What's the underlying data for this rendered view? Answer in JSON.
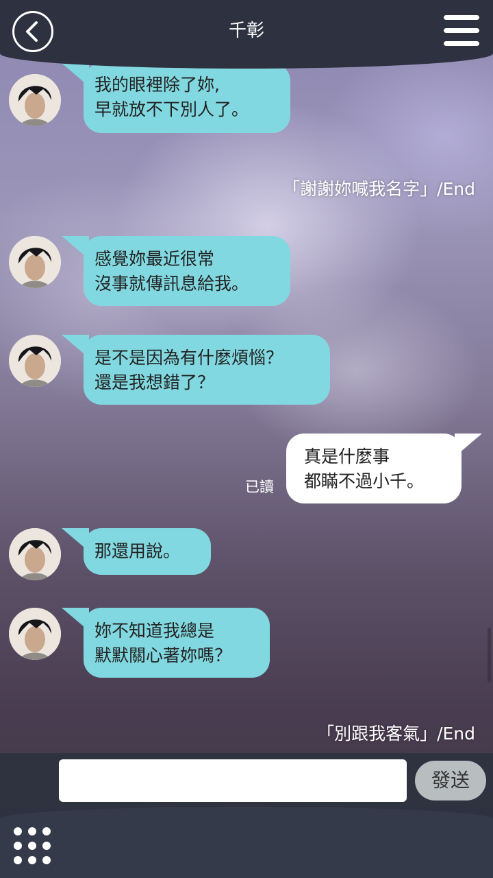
{
  "header": {
    "title": "千彰",
    "back_icon": "chevron-left-icon",
    "menu_icon": "hamburger-menu-icon"
  },
  "messages": [
    {
      "sender": "other",
      "lines": [
        "我的眼裡除了妳,",
        "早就放不下別人了。"
      ]
    },
    {
      "sender": "system",
      "text": "「謝謝妳喊我名字」/End"
    },
    {
      "sender": "other",
      "lines": [
        "感覺妳最近很常",
        "沒事就傳訊息給我。"
      ]
    },
    {
      "sender": "other",
      "lines": [
        "是不是因為有什麼煩惱？",
        "還是我想錯了？"
      ]
    },
    {
      "sender": "me",
      "lines": [
        "真是什麼事",
        "都瞞不過小千。"
      ],
      "status": "已讀"
    },
    {
      "sender": "other",
      "lines": [
        "那還用說。"
      ]
    },
    {
      "sender": "other",
      "lines": [
        "妳不知道我總是",
        "默默關心著妳嗎？"
      ]
    },
    {
      "sender": "system",
      "text": "「別跟我客氣」/End"
    }
  ],
  "composer": {
    "input_value": "",
    "send_label": "發送"
  },
  "bottom": {
    "grid_icon": "grid-menu-icon"
  },
  "colors": {
    "header_bg": "#2e3140",
    "other_bubble": "#82d8e0",
    "my_bubble": "#ffffff",
    "send_button": "#b8bec0"
  }
}
